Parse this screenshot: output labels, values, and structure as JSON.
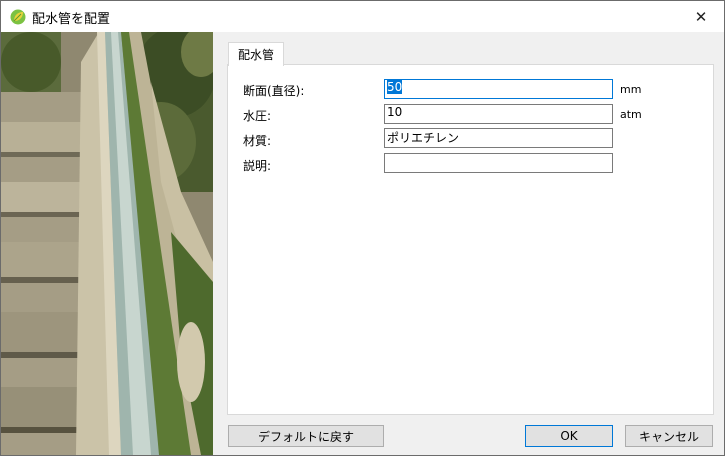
{
  "window": {
    "title": "配水管を配置",
    "close_glyph": "✕"
  },
  "tab": {
    "label": "配水管"
  },
  "form": {
    "diameter": {
      "label": "断面(直径):",
      "value": "50",
      "unit": "mm"
    },
    "pressure": {
      "label": "水圧:",
      "value": "10",
      "unit": "atm"
    },
    "material": {
      "label": "材質:",
      "value": "ポリエチレン"
    },
    "description": {
      "label": "説明:",
      "value": ""
    }
  },
  "buttons": {
    "reset": "デフォルトに戻す",
    "ok": "OK",
    "cancel": "キャンセル"
  },
  "colors": {
    "accent": "#0078d7",
    "panel": "#ffffff",
    "background": "#f0f0f0"
  }
}
